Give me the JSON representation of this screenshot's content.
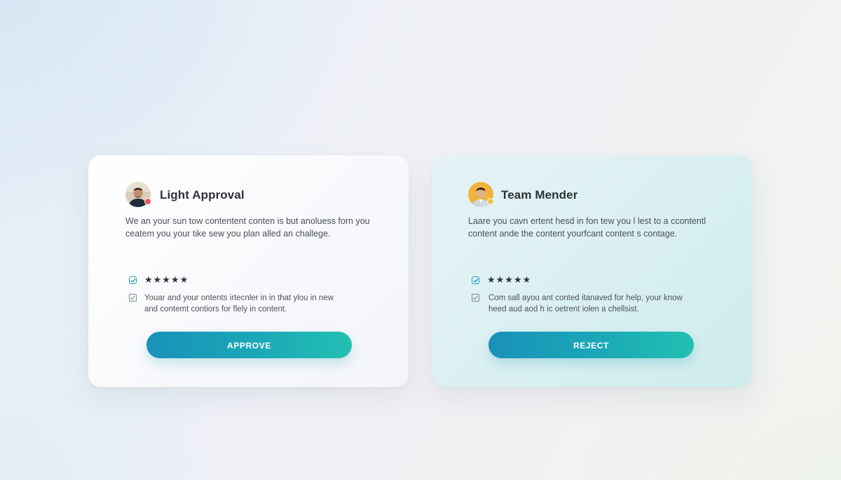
{
  "cards": [
    {
      "title": "Light Approval",
      "description": [
        "We an your sun tow contentent conten is but anoluess forn you",
        "ceatem you your tike sew you plan alled an challege."
      ],
      "rating_stars": "★★★★★",
      "rating": 5,
      "note": [
        "Youar and your ontents irtecnler in in that ylou in new",
        "and contemt contiors for flely in content."
      ],
      "button_label": "APPROVE",
      "status_dot_color": "#e85a5a"
    },
    {
      "title": "Team Mender",
      "description": [
        "Laare you cavn ertent hesd in fon tew you l lest to a ccontentl",
        "content ande the content yourfcant content s contage."
      ],
      "rating_stars": "★★★★★",
      "rating": 5,
      "note": [
        "Com sall ayou ant conted itanaved for help, your know",
        "heed aud aod h ic oetrent iolen a chellsist."
      ],
      "button_label": "REJECT",
      "status_dot_color": "#e7c55a"
    }
  ],
  "colors": {
    "accent_start": "#1991b9",
    "accent_end": "#22c0b1",
    "checkbox_accent": "#1e9fb3"
  },
  "icons": {
    "checked": "checkbox-checked-icon",
    "unchecked": "checkbox-icon",
    "star": "star-icon"
  }
}
